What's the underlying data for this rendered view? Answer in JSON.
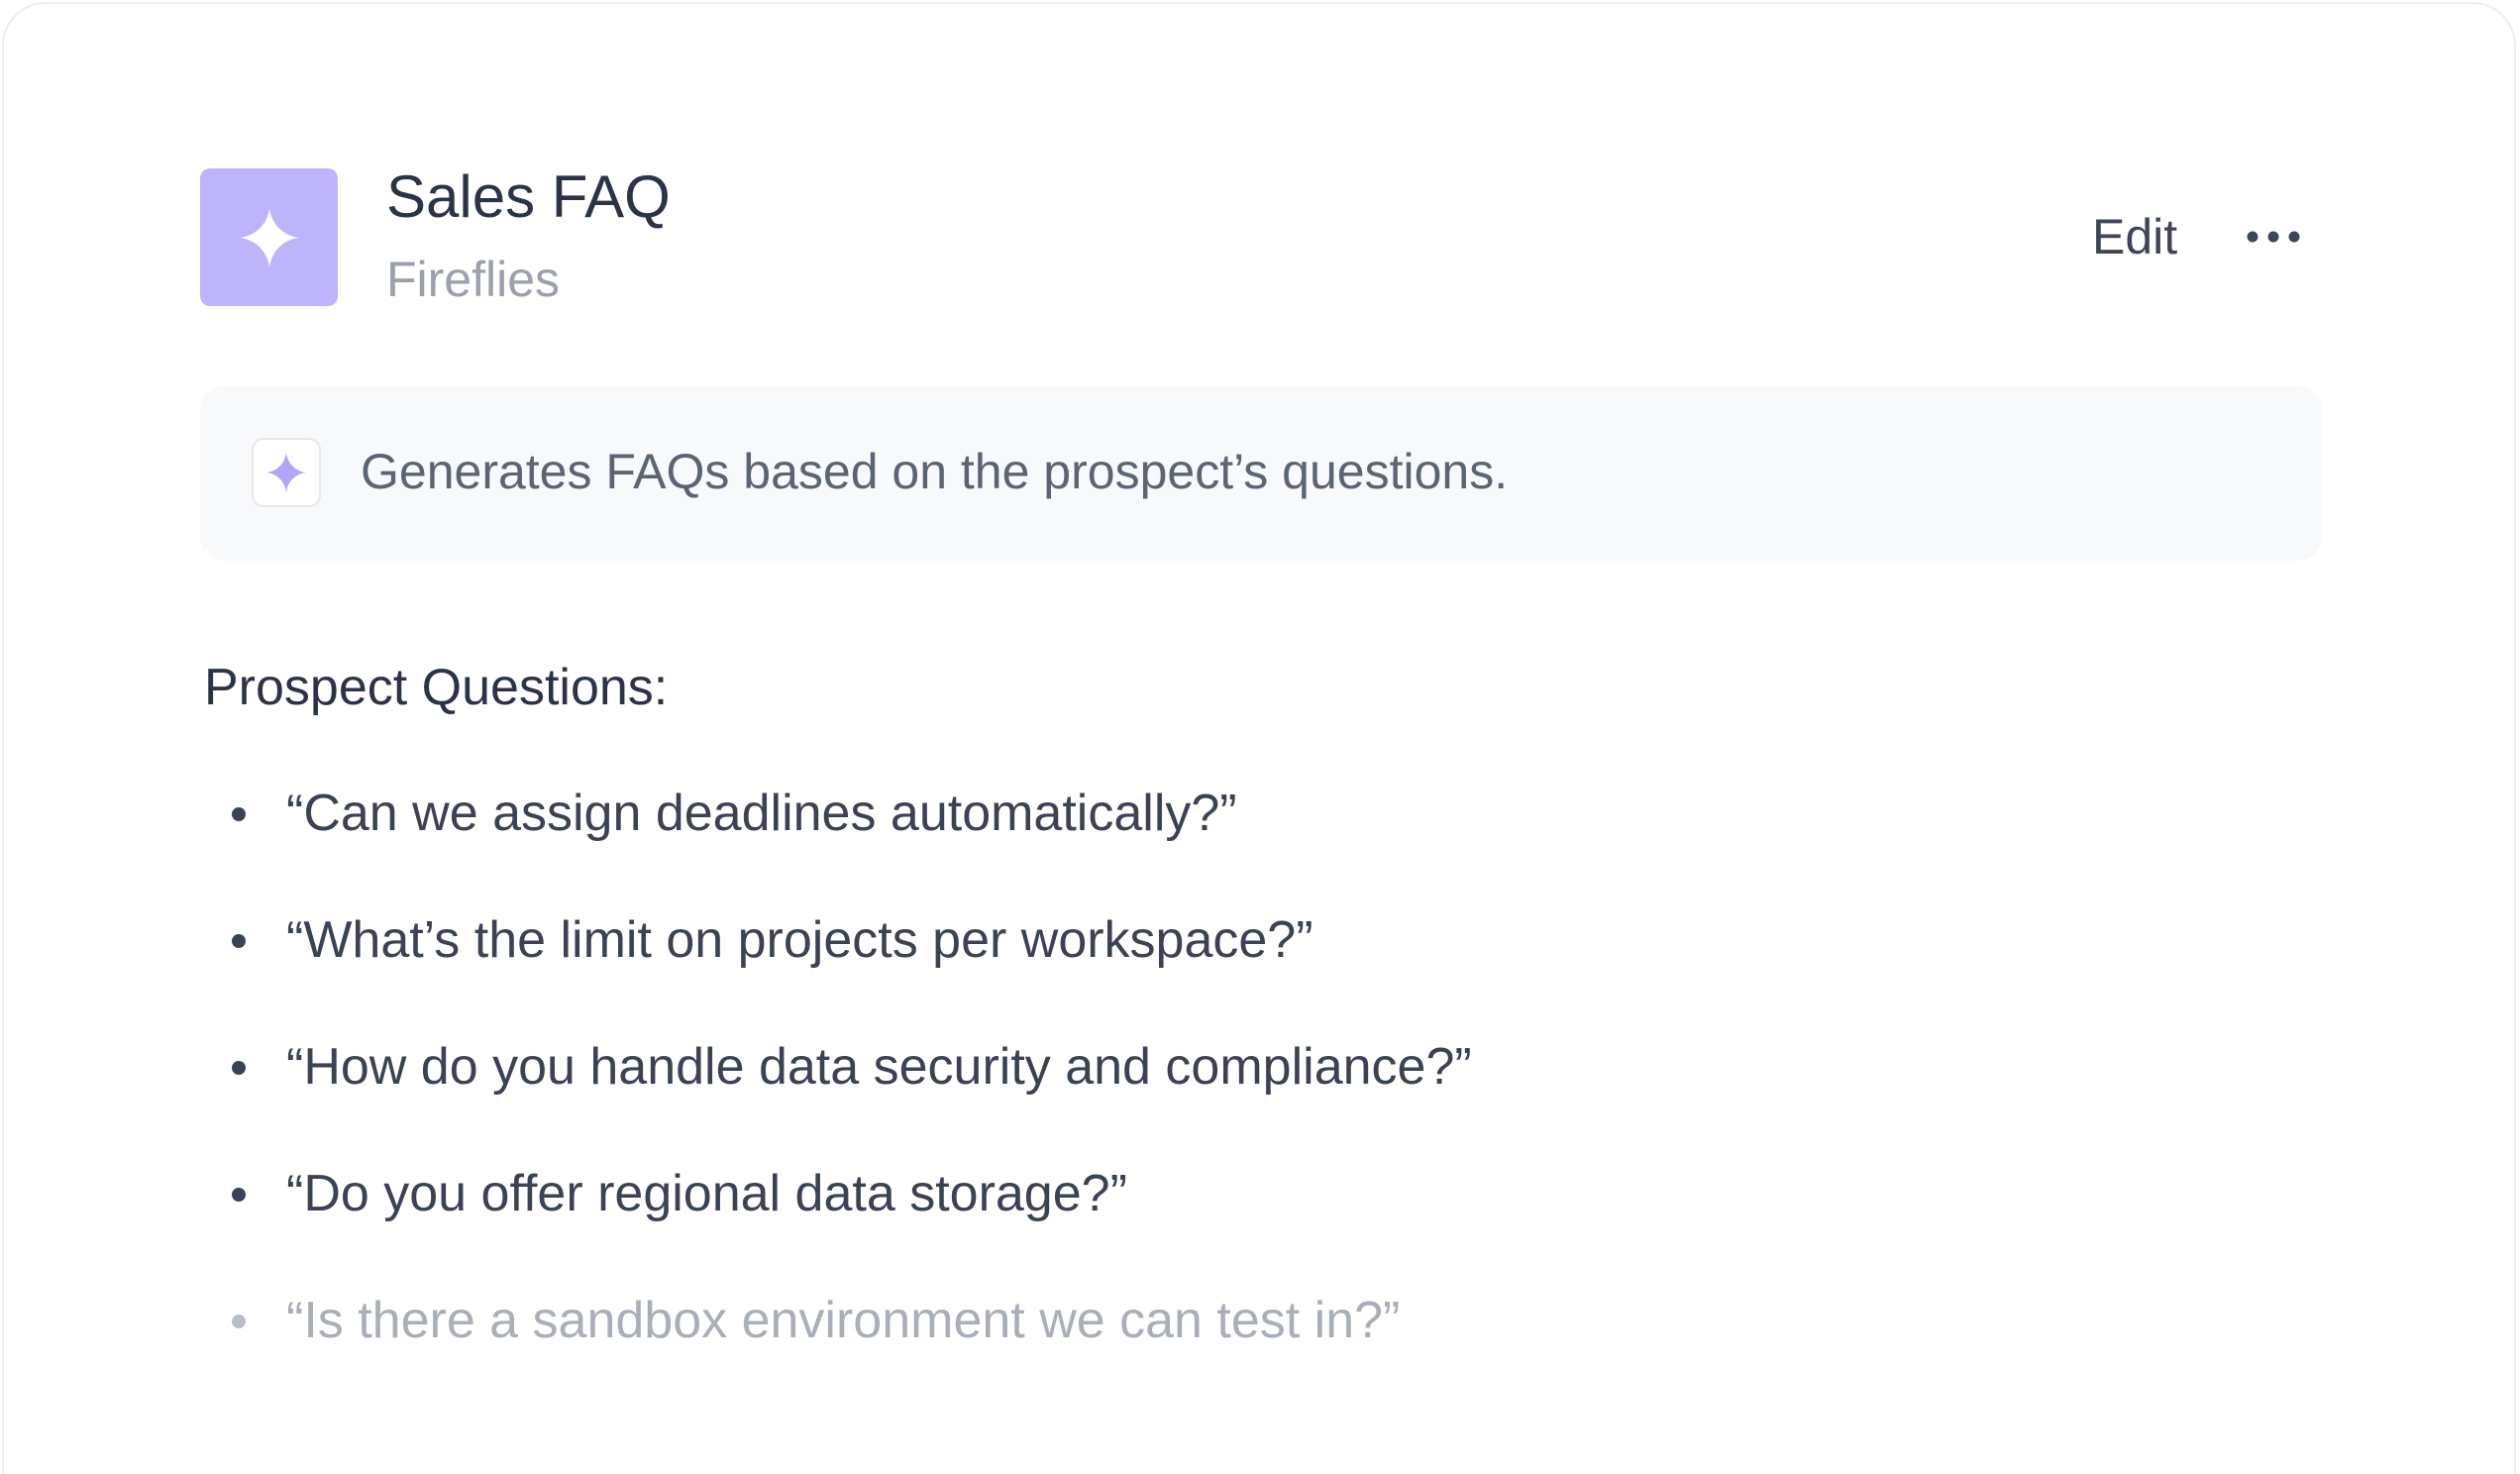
{
  "header": {
    "title": "Sales FAQ",
    "subtitle": "Fireflies",
    "app_icon": "sparkle-icon",
    "edit_label": "Edit",
    "more_icon": "more-horizontal-icon"
  },
  "description": {
    "icon": "sparkle-icon",
    "text": "Generates FAQs based on the prospect’s questions."
  },
  "questions": {
    "heading": "Prospect Questions:",
    "items": [
      "“Can we assign deadlines automatically?”",
      "“What’s the limit on projects per workspace?”",
      "“How do you handle data security and compliance?”",
      "“Do you offer regional data storage?”",
      "“Is there a sandbox environment we can test in?”"
    ]
  },
  "colors": {
    "accent": "#bcb5fb",
    "sparkle_small": "#b0a5fa",
    "text_primary": "#2b3447",
    "text_muted": "#9aa1ad",
    "panel_bg": "#f8f9fa"
  }
}
